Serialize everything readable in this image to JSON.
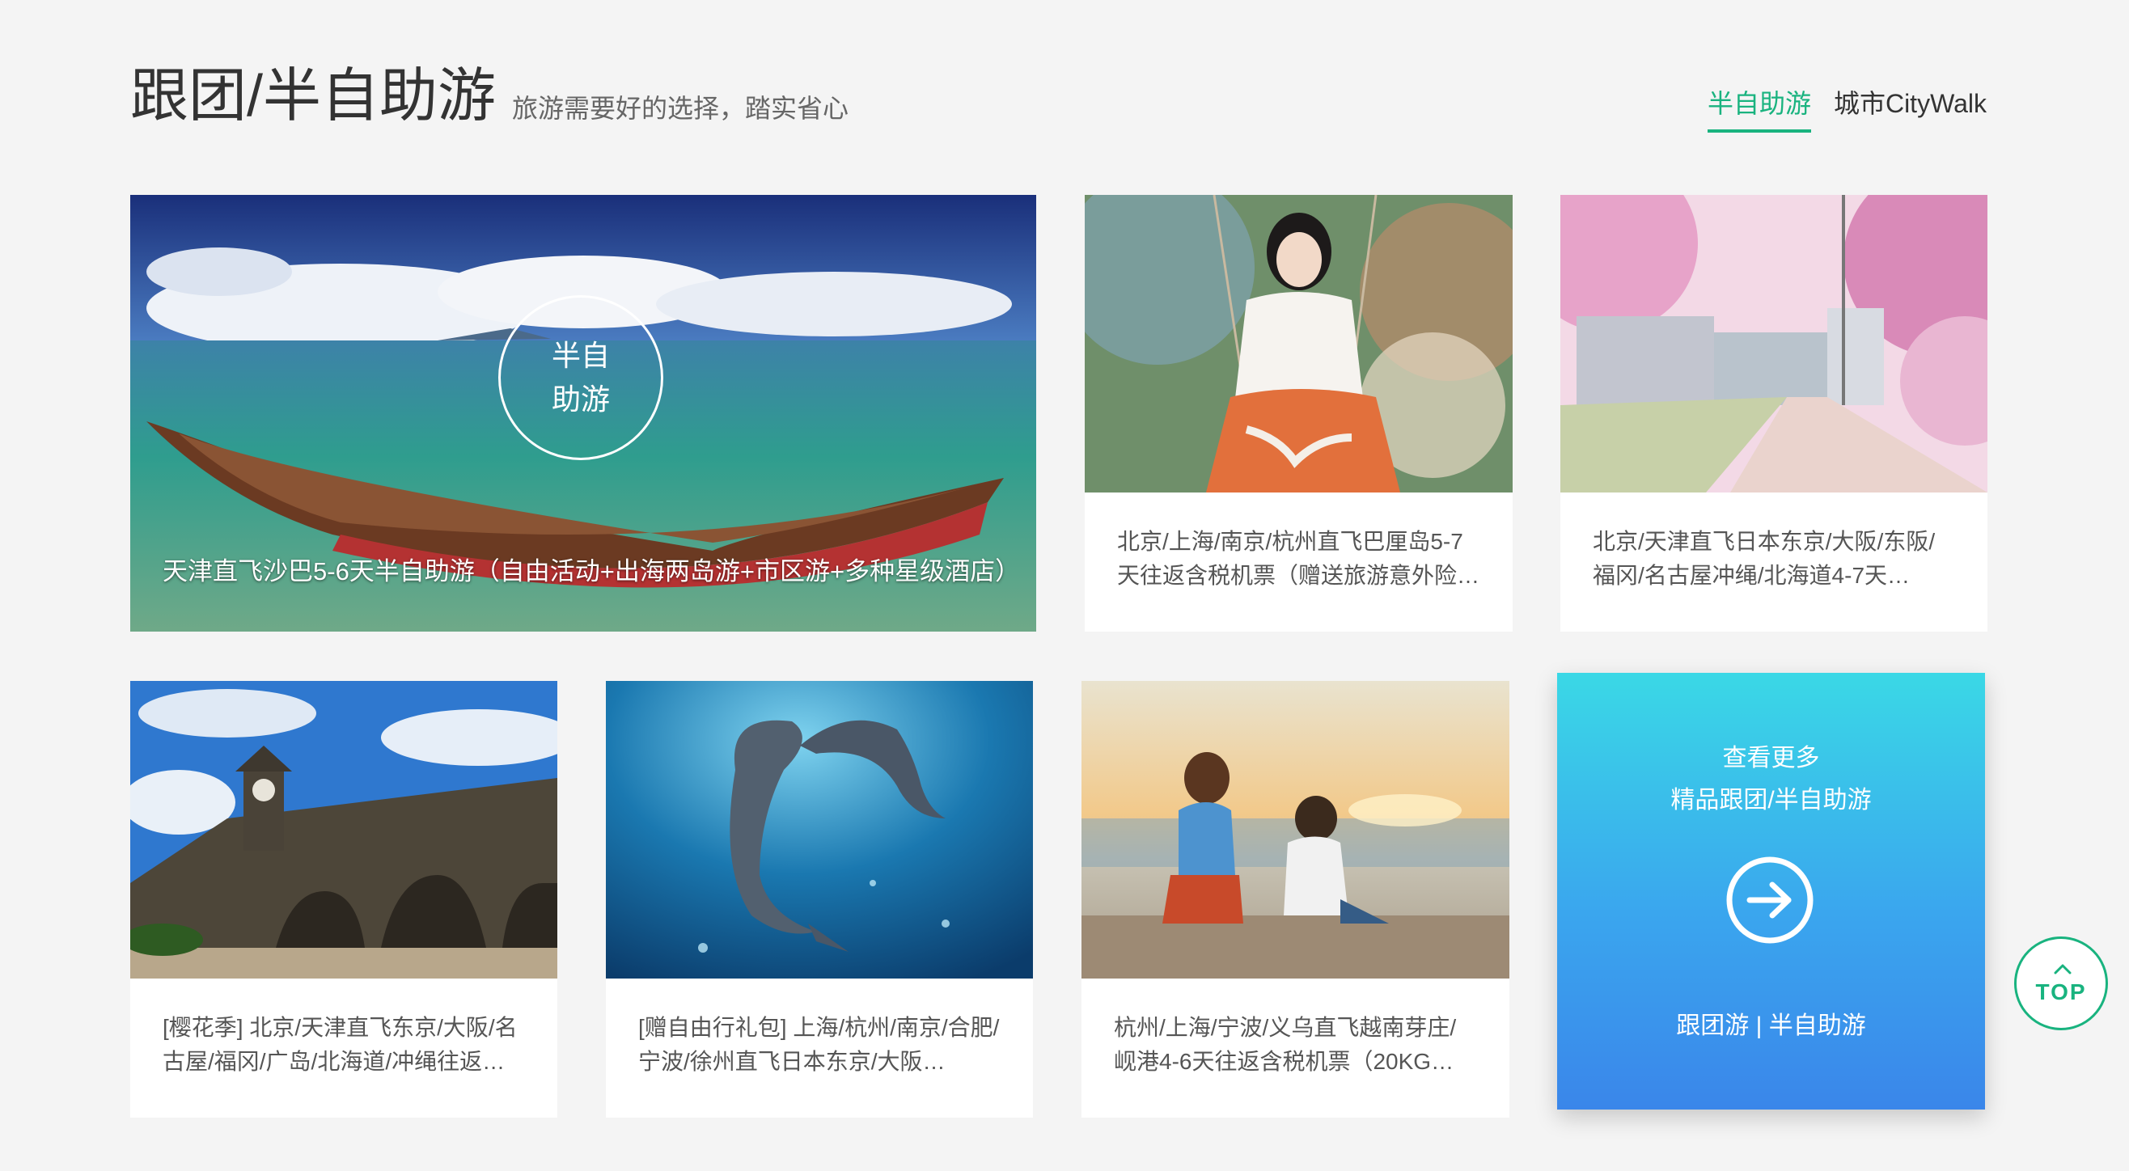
{
  "header": {
    "title": "跟团/半自助游",
    "subtitle": "旅游需要好的选择，踏实省心",
    "tabs": [
      {
        "label": "半自助游",
        "active": true
      },
      {
        "label": "城市CityWalk",
        "active": false
      }
    ]
  },
  "featured": {
    "badge_line1": "半自",
    "badge_line2": "助游",
    "title": "天津直飞沙巴5-6天半自助游（自由活动+出海两岛游+市区游+多种星级酒店）"
  },
  "cards": [
    {
      "title": "北京/上海/南京/杭州直飞巴厘岛5-7天往返含税机票（赠送旅游意外险…"
    },
    {
      "title": "北京/天津直飞日本东京/大阪/东阪/福冈/名古屋冲绳/北海道4-7天…"
    },
    {
      "title": "[樱花季] 北京/天津直飞东京/大阪/名古屋/福冈/广岛/北海道/冲绳往返…"
    },
    {
      "title": "[赠自由行礼包] 上海/杭州/南京/合肥/宁波/徐州直飞日本东京/大阪…"
    },
    {
      "title": "杭州/上海/宁波/义乌直飞越南芽庄/岘港4-6天往返含税机票（20KG…"
    }
  ],
  "more": {
    "line1": "查看更多",
    "line2": "精品跟团/半自助游",
    "line3": "跟团游 | 半自助游"
  },
  "top_button": {
    "label": "TOP"
  },
  "colors": {
    "accent": "#19b37f",
    "background": "#f4f4f4",
    "more_gradient_top": "#3ad8e6",
    "more_gradient_bottom": "#3a86ea"
  },
  "icons": {
    "more_arrow": "arrow-right-circle-icon",
    "top_chevron": "chevron-up-icon"
  }
}
